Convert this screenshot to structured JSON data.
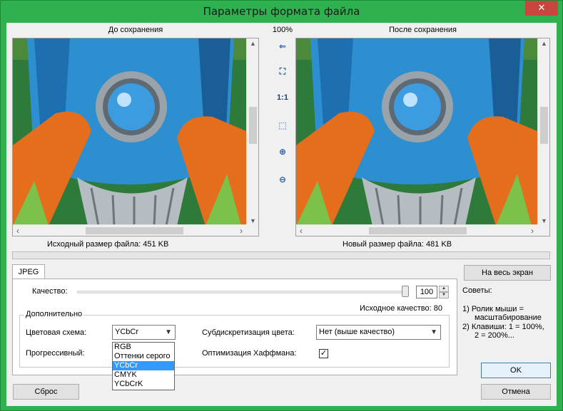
{
  "window": {
    "title": "Параметры формата файла",
    "close_glyph": "✕"
  },
  "preview": {
    "before_title": "До сохранения",
    "after_title": "После сохранения",
    "zoom": "100%",
    "before_size_label": "Исходный размер файла:  451 KB",
    "after_size_label": "Новый размер файла:  481 KB"
  },
  "tools": [
    {
      "name": "sync-arrow-icon",
      "glyph": "⇐"
    },
    {
      "name": "fit-window-icon",
      "glyph": "⛶"
    },
    {
      "name": "actual-size-icon",
      "glyph": "1:1"
    },
    {
      "name": "fit-width-icon",
      "glyph": "⬚"
    },
    {
      "name": "zoom-in-icon",
      "glyph": "⊕"
    },
    {
      "name": "zoom-out-icon",
      "glyph": "⊖"
    }
  ],
  "tabs": {
    "active": "JPEG"
  },
  "quality": {
    "label": "Качество:",
    "value": "100",
    "original_quality": "Исходное качество: 80"
  },
  "advanced": {
    "group_title": "Дополнительно",
    "color_scheme_label": "Цветовая схема:",
    "color_scheme_value": "YCbCr",
    "color_scheme_options": [
      "RGB",
      "Оттенки серого",
      "YCbCr",
      "CMYK",
      "YCbCrK"
    ],
    "subsampling_label": "Субдискретизация цвета:",
    "subsampling_value": "Нет (выше качество)",
    "progressive_label": "Прогрессивный:",
    "huffman_label": "Оптимизация Хаффмана:",
    "huffman_checked": "✓"
  },
  "buttons": {
    "fullscreen": "На весь экран",
    "ok": "OK",
    "cancel": "Отмена",
    "reset": "Сброс"
  },
  "tips": {
    "title": "Советы:",
    "line1": "1) Ролик мыши =",
    "line2": "масштабирование",
    "line3": "2) Клавиши: 1 = 100%,",
    "line4": "2 = 200%..."
  },
  "colors": {
    "titlebar": "#2fb14f",
    "close": "#c7463e",
    "selection": "#3399ff"
  }
}
